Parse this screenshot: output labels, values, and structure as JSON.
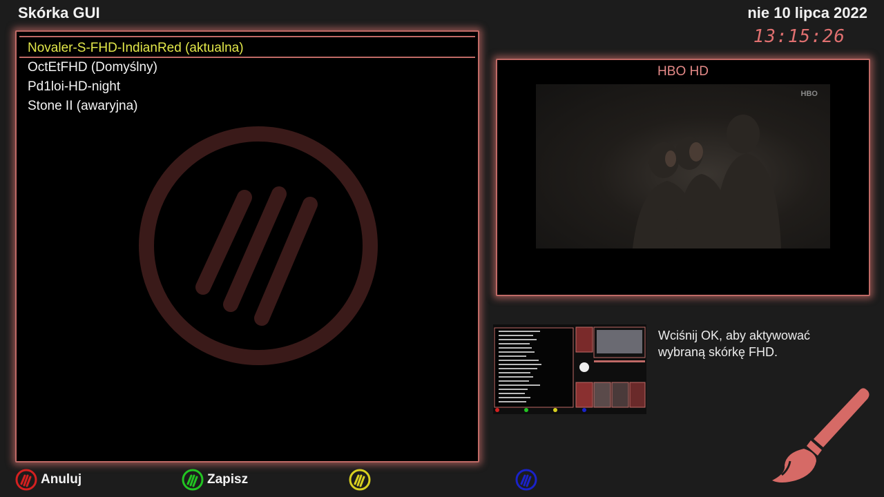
{
  "header": {
    "title": "Skórka GUI",
    "date": "nie 10 lipca 2022",
    "time": "13:15:26"
  },
  "skins": [
    {
      "label": "Novaler-S-FHD-IndianRed (aktualna)",
      "selected": true
    },
    {
      "label": "OctEtFHD (Domyślny)",
      "selected": false
    },
    {
      "label": "Pd1loi-HD-night",
      "selected": false
    },
    {
      "label": "Stone II (awaryjna)",
      "selected": false
    }
  ],
  "preview": {
    "channel": "HBO HD",
    "video_logo": "HBO"
  },
  "info": {
    "text": "Wciśnij OK, aby aktywować wybraną skórkę FHD."
  },
  "footer": {
    "red_label": "Anuluj",
    "green_label": "Zapisz",
    "yellow_label": "",
    "blue_label": ""
  },
  "colors": {
    "accent": "#c06a66",
    "selected_text": "#e3e84a",
    "clock": "#e07070",
    "red": "#d42020",
    "green": "#22c422",
    "yellow": "#d8d020",
    "blue": "#1a22c8"
  },
  "icons": {
    "watermark": "novaler-logo-icon",
    "brush": "paintbrush-icon"
  }
}
